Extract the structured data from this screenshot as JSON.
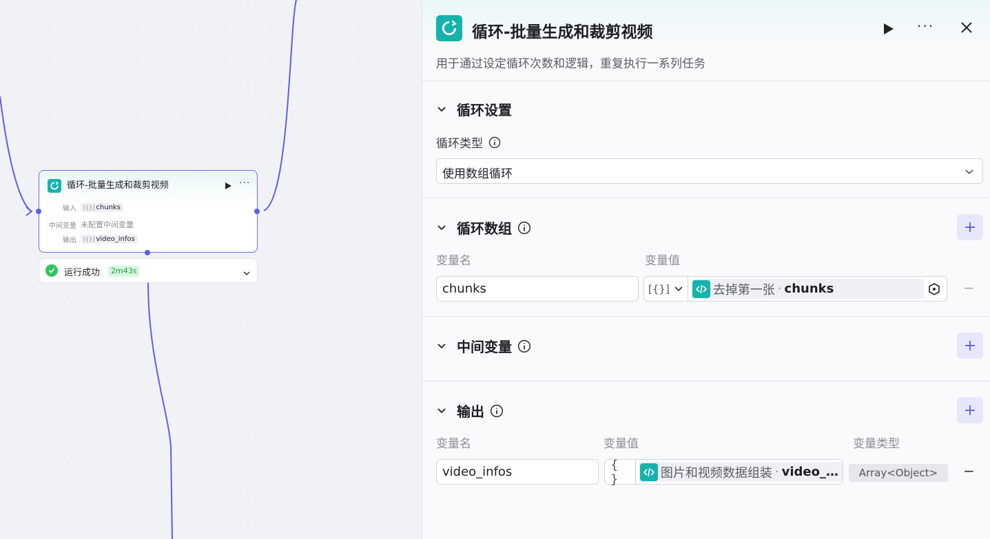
{
  "node": {
    "title": "循环-批量生成和裁剪视频",
    "input_label": "输入",
    "input_value": "chunks",
    "mid_label": "中间变量",
    "mid_value": "未配置中间变量",
    "output_label": "输出",
    "output_value": "video_infos",
    "status_text": "运行成功",
    "status_time": "2m43s",
    "array_glyph": "[{}]"
  },
  "panel": {
    "title": "循环-批量生成和裁剪视频",
    "description": "用于通过设定循环次数和逻辑，重复执行一系列任务",
    "loop_settings": {
      "title": "循环设置",
      "type_label": "循环类型",
      "type_value": "使用数组循环"
    },
    "loop_array": {
      "title": "循环数组",
      "col_name": "变量名",
      "col_value": "变量值",
      "row": {
        "name": "chunks",
        "type_glyph": "[{}]",
        "ref_node": "去掉第一张",
        "ref_var": "chunks"
      }
    },
    "intermediate": {
      "title": "中间变量"
    },
    "output": {
      "title": "输出",
      "col_name": "变量名",
      "col_value": "变量值",
      "col_type": "变量类型",
      "row": {
        "name": "video_infos",
        "type_glyph": "{ }",
        "ref_node": "图片和视频数据组装",
        "ref_var": "video_…",
        "var_type": "Array<Object>"
      }
    }
  },
  "colors": {
    "accent": "#5e5ee6",
    "node_teal": "#16b3ac",
    "success": "#32c45e"
  }
}
